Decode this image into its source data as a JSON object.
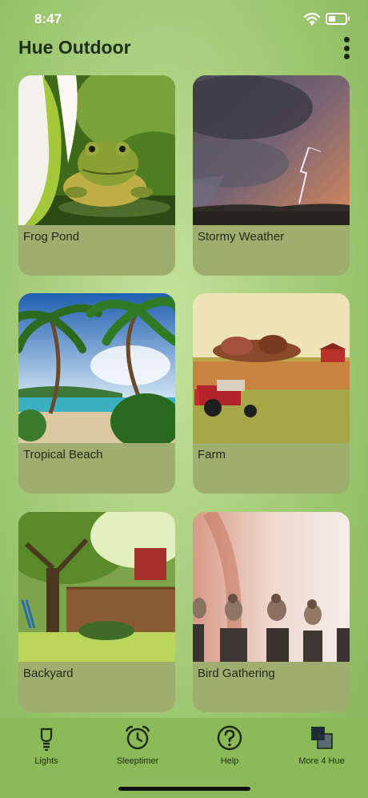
{
  "status_bar": {
    "time": "8:47"
  },
  "header": {
    "title": "Hue Outdoor"
  },
  "scenes": [
    {
      "label": "Frog Pond"
    },
    {
      "label": "Stormy Weather"
    },
    {
      "label": "Tropical Beach"
    },
    {
      "label": "Farm"
    },
    {
      "label": "Backyard"
    },
    {
      "label": "Bird Gathering"
    }
  ],
  "tab_bar": {
    "tabs": [
      {
        "label": "Lights",
        "icon": "bulb-icon"
      },
      {
        "label": "Sleeptimer",
        "icon": "alarm-clock-icon"
      },
      {
        "label": "Help",
        "icon": "question-icon"
      },
      {
        "label": "More 4 Hue",
        "icon": "squares-icon"
      }
    ]
  },
  "colors": {
    "background": "#aed283",
    "card": "#9fae6f",
    "tab_bar": "#8bb957"
  }
}
